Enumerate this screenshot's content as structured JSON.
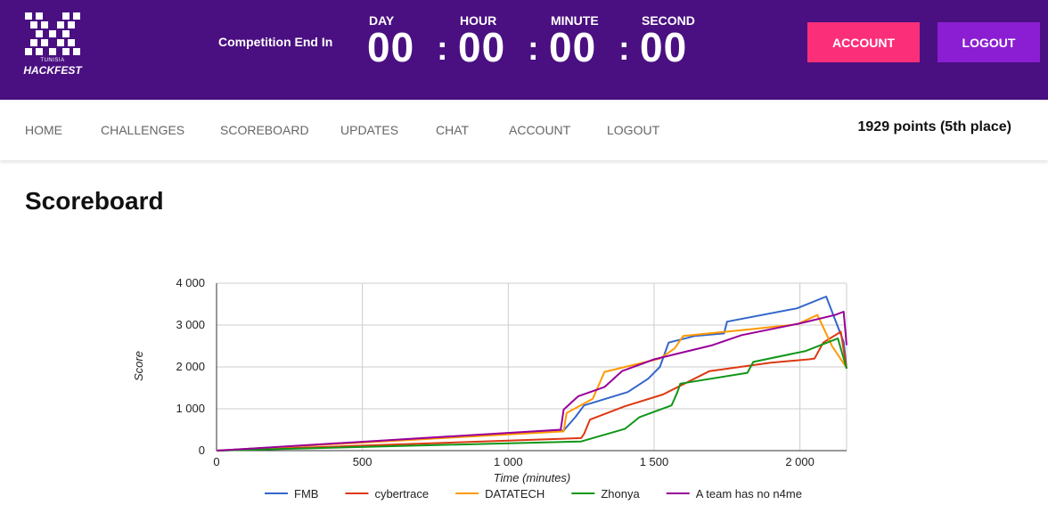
{
  "logo": {
    "top_text": "TUNISIA",
    "name": "HACKFEST"
  },
  "countdown": {
    "label": "Competition End In",
    "units": [
      {
        "label": "DAY",
        "value": "00"
      },
      {
        "label": "HOUR",
        "value": "00"
      },
      {
        "label": "MINUTE",
        "value": "00"
      },
      {
        "label": "SECOND",
        "value": "00"
      }
    ],
    "separator": ":"
  },
  "header_buttons": {
    "account": "ACCOUNT",
    "logout": "LOGOUT"
  },
  "nav": {
    "items": [
      "HOME",
      "CHALLENGES",
      "SCOREBOARD",
      "UPDATES",
      "CHAT",
      "ACCOUNT",
      "LOGOUT"
    ],
    "points": "1929 points (5th place)"
  },
  "page": {
    "title": "Scoreboard"
  },
  "colors": {
    "header_bg": "#4a1081",
    "account_button": "#fb2f79",
    "logout_button": "#8b1ed2"
  },
  "chart_data": {
    "type": "line",
    "title": "",
    "xlabel": "Time (minutes)",
    "ylabel": "Score",
    "xlim": [
      0,
      2160
    ],
    "ylim": [
      0,
      4000
    ],
    "x_ticks": [
      0,
      500,
      1000,
      1500,
      2000
    ],
    "x_tick_labels": [
      "0",
      "500",
      "1 000",
      "1 500",
      "2 000"
    ],
    "y_ticks": [
      0,
      1000,
      2000,
      3000,
      4000
    ],
    "y_tick_labels": [
      "0",
      "1 000",
      "2 000",
      "3 000",
      "4 000"
    ],
    "grid": true,
    "legend_position": "bottom",
    "series": [
      {
        "name": "FMB",
        "color": "#3366cc",
        "x": [
          0,
          1190,
          1230,
          1260,
          1410,
          1480,
          1520,
          1550,
          1640,
          1740,
          1750,
          1990,
          2090,
          2150,
          2160
        ],
        "y": [
          0,
          480,
          800,
          1080,
          1400,
          1720,
          2000,
          2580,
          2740,
          2800,
          3080,
          3400,
          3680,
          2600,
          1960
        ]
      },
      {
        "name": "cybertrace",
        "color": "#dc3912",
        "x": [
          0,
          1250,
          1260,
          1280,
          1400,
          1530,
          1690,
          1900,
          2030,
          2050,
          2080,
          2140,
          2160
        ],
        "y": [
          0,
          300,
          400,
          740,
          1060,
          1340,
          1900,
          2100,
          2180,
          2200,
          2580,
          2840,
          1960
        ]
      },
      {
        "name": "DATATECH",
        "color": "#ff9900",
        "x": [
          0,
          1190,
          1200,
          1290,
          1330,
          1520,
          1570,
          1600,
          1830,
          1990,
          2060,
          2110,
          2160
        ],
        "y": [
          0,
          460,
          900,
          1240,
          1880,
          2200,
          2440,
          2740,
          2900,
          3020,
          3240,
          2500,
          1980
        ]
      },
      {
        "name": "Zhonya",
        "color": "#109618",
        "x": [
          0,
          1250,
          1400,
          1450,
          1560,
          1580,
          1590,
          1820,
          1840,
          2020,
          2130,
          2160
        ],
        "y": [
          0,
          220,
          520,
          800,
          1080,
          1400,
          1600,
          1860,
          2120,
          2380,
          2680,
          1960
        ]
      },
      {
        "name": "A team has no n4me",
        "color": "#990099",
        "x": [
          0,
          1180,
          1190,
          1240,
          1330,
          1390,
          1500,
          1700,
          1800,
          2000,
          2120,
          2150,
          2160
        ],
        "y": [
          0,
          500,
          980,
          1300,
          1520,
          1900,
          2180,
          2520,
          2760,
          3040,
          3240,
          3320,
          2520
        ]
      }
    ]
  }
}
